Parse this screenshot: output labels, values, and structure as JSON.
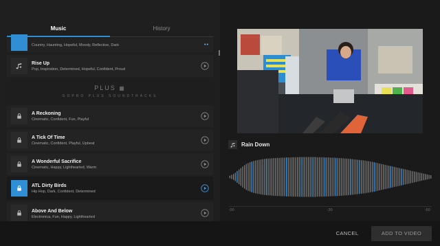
{
  "tabs": {
    "music_label": "Music",
    "history_label": "History"
  },
  "tracks": [
    {
      "title": "",
      "tags": "Country, Haunting, Hopeful, Moody, Reflective, Dark",
      "icon": "music-note-icon"
    },
    {
      "title": "Rise Up",
      "tags": "Pop, Inspiration, Determined, Hopeful, Confident, Proud",
      "icon": "music-note-icon"
    },
    {
      "title": "A Reckoning",
      "tags": "Cinematic, Confident, Fun, Playful",
      "icon": "lock-icon"
    },
    {
      "title": "A Tick Of Time",
      "tags": "Cinematic, Confident, Playful, Upbeat",
      "icon": "lock-icon"
    },
    {
      "title": "A Wonderful Sacrifice",
      "tags": "Cinematic, Happy, Lighthearted, Warm",
      "icon": "lock-icon"
    },
    {
      "title": "ATL Dirty Birds",
      "tags": "Hip Hop, Dark, Confident, Determined",
      "icon": "lock-icon",
      "selected": true
    },
    {
      "title": "Above And Below",
      "tags": "Electronica, Fun, Happy, Lighthearted",
      "icon": "lock-icon"
    }
  ],
  "plus_banner": {
    "logo": "PLUS",
    "subtitle": "GOPRO PLUS SOUNDTRACKS"
  },
  "now_playing": {
    "title": "Rain Down",
    "icon": "music-note-icon"
  },
  "timeline": {
    "labels": [
      ":00",
      ":30",
      ":60"
    ]
  },
  "waveform": {
    "amplitudes": [
      0.06,
      0.1,
      0.14,
      0.2,
      0.28,
      0.35,
      0.42,
      0.5,
      0.56,
      0.62,
      0.66,
      0.7,
      0.73,
      0.76,
      0.78,
      0.8,
      0.82,
      0.83,
      0.85,
      0.86,
      0.87,
      0.88,
      0.88,
      0.89,
      0.9,
      0.9,
      0.91,
      0.91,
      0.92,
      0.92,
      0.92,
      0.93,
      0.93,
      0.93,
      0.94,
      0.94,
      0.94,
      0.94,
      0.95,
      0.95,
      0.95,
      0.95,
      0.95,
      0.95,
      0.95,
      0.95,
      0.95,
      0.95,
      0.94,
      0.94,
      0.94,
      0.94,
      0.93,
      0.93,
      0.93,
      0.92,
      0.92,
      0.92,
      0.91,
      0.91,
      0.9,
      0.9,
      0.89,
      0.88,
      0.88,
      0.87,
      0.86,
      0.85,
      0.84,
      0.83,
      0.82,
      0.81,
      0.8,
      0.79,
      0.78,
      0.76,
      0.75,
      0.73,
      0.72,
      0.7,
      0.68,
      0.66,
      0.64,
      0.62,
      0.6,
      0.58,
      0.56,
      0.54,
      0.52,
      0.5,
      0.48,
      0.46,
      0.44,
      0.42,
      0.4,
      0.38,
      0.36,
      0.34,
      0.32,
      0.3,
      0.28,
      0.26,
      0.24,
      0.22,
      0.2,
      0.18,
      0.16,
      0.14,
      0.12,
      0.1,
      0.08
    ],
    "highlighted": [
      4,
      12,
      20,
      31,
      39,
      45,
      52,
      58,
      66,
      71,
      79,
      88,
      94
    ],
    "bar_color": "#7a7a7a",
    "highlight_color": "#3a9be6"
  },
  "footer": {
    "cancel_label": "CANCEL",
    "add_label": "ADD TO VIDEO"
  },
  "colors": {
    "accent": "#2d8fd6"
  }
}
